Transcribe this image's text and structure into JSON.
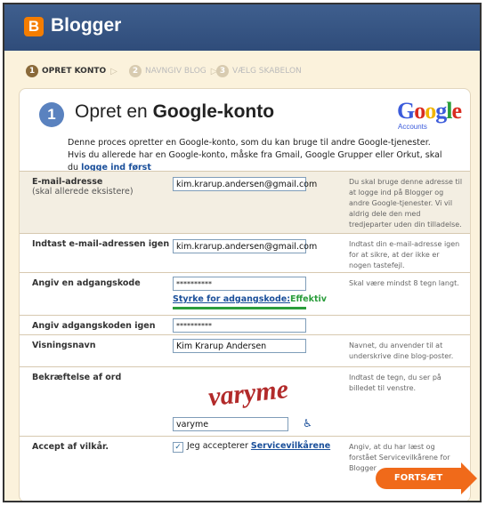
{
  "brand": {
    "logo_letter": "B",
    "name": "Blogger"
  },
  "steps": [
    {
      "num": "1",
      "label": "OPRET KONTO"
    },
    {
      "num": "2",
      "label": "NAVNGIV BLOG"
    },
    {
      "num": "3",
      "label": "VÆLG SKABELON"
    }
  ],
  "panel": {
    "step_num": "1",
    "title_prefix": "Opret en ",
    "title_bold": "Google-konto",
    "google_letters": [
      "G",
      "o",
      "o",
      "g",
      "l",
      "e"
    ],
    "google_sub": "Accounts",
    "intro_text": "Denne proces opretter en Google-konto, som du kan bruge til andre Google-tjenester. Hvis du allerede har en Google-konto, måske fra Gmail, Google Grupper eller Orkut, skal du ",
    "intro_link": "logge ind først"
  },
  "form": {
    "email": {
      "label": "E-mail-adresse",
      "sub": "(skal allerede eksistere)",
      "value": "kim.krarup.andersen@gmail.com",
      "help": "Du skal bruge denne adresse til at logge ind på Blogger og andre Google-tjenester. Vi vil aldrig dele den med tredjeparter uden din tilladelse."
    },
    "email_confirm": {
      "label": "Indtast e-mail-adressen igen",
      "value": "kim.krarup.andersen@gmail.com",
      "help": "Indtast din e-mail-adresse igen for at sikre, at der ikke er nogen tastefejl."
    },
    "password": {
      "label": "Angiv en adgangskode",
      "value": "**********",
      "strength_label": "Styrke for adgangskode:",
      "strength_value": "Effektiv",
      "help": "Skal være mindst 8 tegn langt."
    },
    "password_confirm": {
      "label": "Angiv adgangskoden igen",
      "value": "**********"
    },
    "display_name": {
      "label": "Visningsnavn",
      "value": "Kim Krarup Andersen",
      "help": "Navnet, du anvender til at underskrive dine blog-poster."
    },
    "captcha": {
      "label": "Bekræftelse af ord",
      "image_text": "varyme",
      "value": "varyme",
      "help": "Indtast de tegn, du ser på billedet til venstre."
    },
    "terms": {
      "label": "Accept af vilkår.",
      "text": "Jeg accepterer ",
      "link": "Servicevilkårene",
      "help": "Angiv, at du har læst og forstået Servicevilkårene for Blogger"
    },
    "continue_label": "FORTSÆT"
  },
  "colors": {
    "header": "#3f5f8e",
    "accent": "#f06a1a",
    "link": "#1a4f9a",
    "strength": "#2a9d3b"
  },
  "icons": {
    "step_arrow": "triangle-right-icon",
    "accessibility": "wheelchair-icon"
  }
}
